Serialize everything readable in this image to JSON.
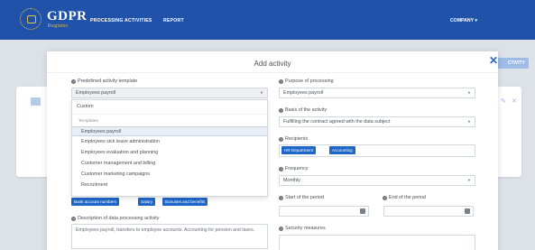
{
  "nav": {
    "logo_title": "GDPR",
    "logo_subtitle": "Register",
    "items": [
      "PROCESSING ACTIVITIES",
      "REPORT"
    ],
    "company": "COMPANY ▾"
  },
  "background": {
    "activity_button": "CTIVITY"
  },
  "modal": {
    "title": "Add activity",
    "close": "✕",
    "template": {
      "label": "Predefined activity template",
      "value": "Employees payroll"
    },
    "dropdown": {
      "custom": "Custom",
      "group_label": "Templates",
      "options": [
        "Employees payroll",
        "Employees sick leave administration",
        "Employees evaluation and planning",
        "Customer management and billing",
        "Customer marketing campaigns",
        "Recruitment"
      ],
      "selected_index": 0
    },
    "data_tags": [
      "Bank account numbers",
      "Salary",
      "Bonuses and benefits"
    ],
    "description": {
      "label": "Description of data processing activity",
      "value": "Employees payroll, transfers to employee accounts. Accounting for pension and taxes."
    },
    "purpose": {
      "label": "Purpose of processing",
      "value": "Employees payroll"
    },
    "basis": {
      "label": "Basis of the activity",
      "value": "Fulfilling the contract agreed with the data subject"
    },
    "recipients": {
      "label": "Recipients",
      "tags": [
        "HR Department",
        "Accounting"
      ]
    },
    "frequency": {
      "label": "Frequency",
      "value": "Monthly"
    },
    "start_period": {
      "label": "Start of the period"
    },
    "end_period": {
      "label": "End of the period"
    },
    "security": {
      "label": "Security measures"
    }
  }
}
